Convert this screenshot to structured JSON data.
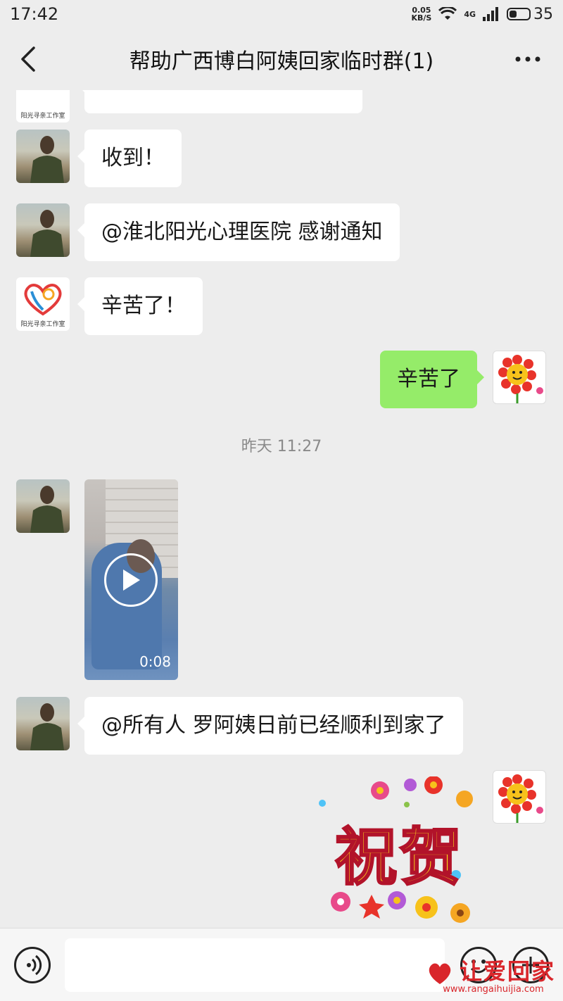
{
  "status_bar": {
    "time": "17:42",
    "net_speed_value": "0.05",
    "net_speed_unit": "KB/S",
    "network_type": "4G",
    "battery": "35"
  },
  "header": {
    "title": "帮助广西博白阿姨回家临时群(1)",
    "back_icon": "chevron-left-icon",
    "more_icon": "more-dots-icon"
  },
  "messages": [
    {
      "sender": "阳光寻亲工作室",
      "side": "left",
      "type": "text",
      "text": "",
      "partial": true
    },
    {
      "sender": "man",
      "side": "left",
      "type": "text",
      "text": "收到！"
    },
    {
      "sender": "man",
      "side": "left",
      "type": "text",
      "text": "@淮北阳光心理医院  感谢通知"
    },
    {
      "sender": "阳光寻亲工作室",
      "side": "left",
      "type": "text",
      "text": "辛苦了！"
    },
    {
      "sender": "self",
      "side": "right",
      "type": "text",
      "text": "辛苦了"
    },
    {
      "sender": "man",
      "side": "left",
      "type": "video",
      "duration": "0:08"
    },
    {
      "sender": "man",
      "side": "left",
      "type": "text",
      "text": "@所有人  罗阿姨日前已经顺利到家了"
    },
    {
      "sender": "self",
      "side": "right",
      "type": "sticker",
      "text": "祝贺"
    }
  ],
  "timestamp": "昨天 11:27",
  "logo_caption": "阳光寻亲工作室",
  "input_bar": {
    "voice_icon": "voice-icon",
    "emoji_icon": "emoji-icon",
    "plus_icon": "plus-icon",
    "placeholder": ""
  },
  "watermark": {
    "title": "让爱回家",
    "url": "www.rangaihuijia.com"
  },
  "colors": {
    "background": "#ededed",
    "self_bubble": "#95ec69",
    "other_bubble": "#ffffff",
    "watermark": "#d9262b"
  }
}
